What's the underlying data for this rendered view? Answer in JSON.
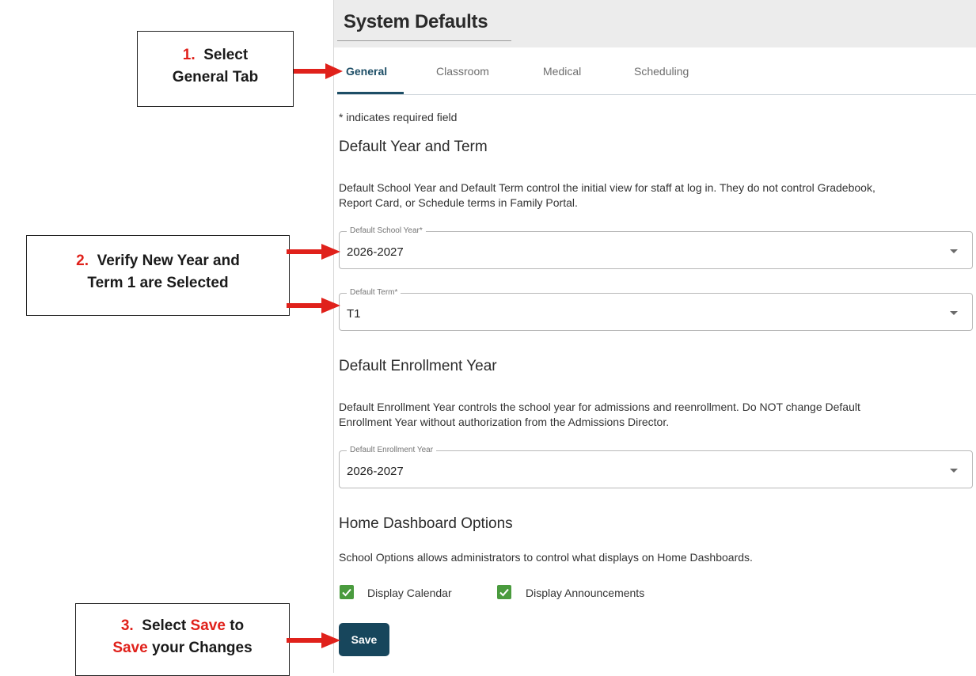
{
  "page": {
    "title": "System Defaults",
    "tabs": [
      "General",
      "Classroom",
      "Medical",
      "Scheduling"
    ],
    "required_note": "* indicates required field"
  },
  "default_year_term": {
    "heading": "Default Year and Term",
    "description_line1": "Default School Year and Default Term control the initial view for staff at log in. They do not control Gradebook,",
    "description_line2": "Report Card, or Schedule terms in Family Portal.",
    "school_year": {
      "label": "Default School Year*",
      "value": "2026-2027"
    },
    "term": {
      "label": "Default Term*",
      "value": "T1"
    }
  },
  "enrollment": {
    "heading": "Default Enrollment Year",
    "description_line1": "Default Enrollment Year controls the school year for admissions and reenrollment. Do NOT change Default",
    "description_line2": "Enrollment Year without authorization from the Admissions Director.",
    "field": {
      "label": "Default Enrollment Year",
      "value": "2026-2027"
    }
  },
  "dashboard": {
    "heading": "Home Dashboard Options",
    "description": "School Options allows administrators to control what displays on Home Dashboards.",
    "options": [
      {
        "label": "Display Calendar",
        "checked": true
      },
      {
        "label": "Display Announcements",
        "checked": true
      }
    ]
  },
  "actions": {
    "save_label": "Save"
  },
  "callouts": {
    "c1": {
      "num": "1.",
      "line1": "Select",
      "line2": "General Tab"
    },
    "c2": {
      "num": "2.",
      "line1": "Verify New Year and",
      "line2": "Term 1 are Selected"
    },
    "c3": {
      "num": "3.",
      "line1_a": "Select",
      "line1_b": "Save",
      "line1_c": "to",
      "line2_a": "Save",
      "line2_b": "your Changes"
    }
  },
  "colors": {
    "accent": "#1d4e66",
    "save_button": "#17465c",
    "checkbox": "#4a9b3e",
    "callout_red": "#e0211b",
    "arrow_red": "#e0211b"
  }
}
